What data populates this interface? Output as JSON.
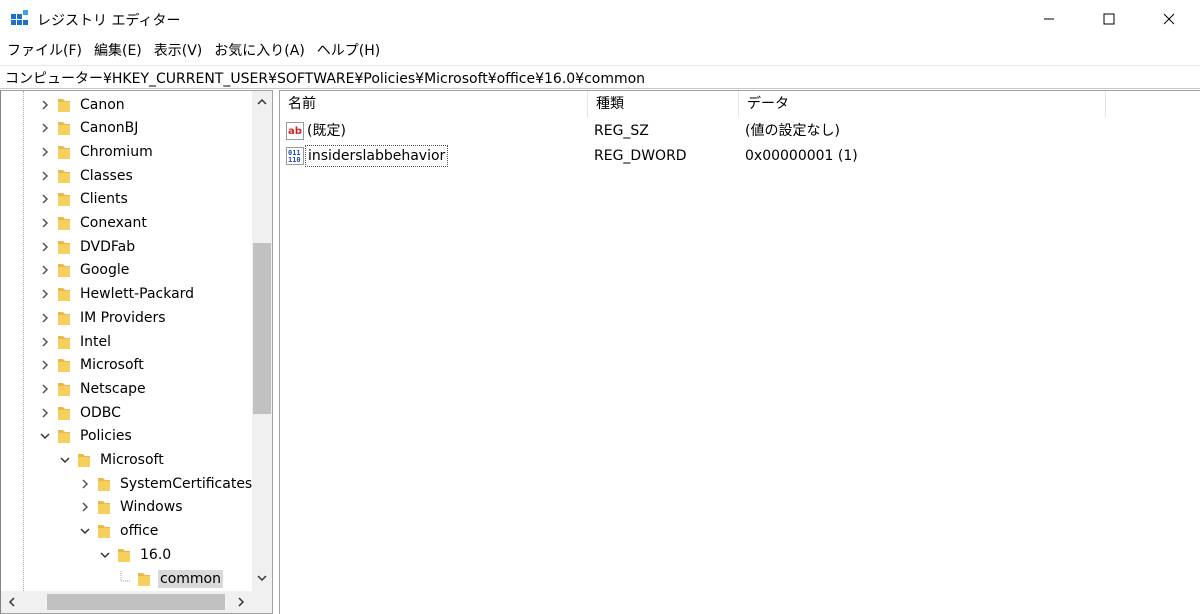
{
  "window": {
    "title": "レジストリ エディター",
    "icon": "regedit-app-icon"
  },
  "menu": [
    "ファイル(F)",
    "編集(E)",
    "表示(V)",
    "お気に入り(A)",
    "ヘルプ(H)"
  ],
  "address": "コンピューター¥HKEY_CURRENT_USER¥SOFTWARE¥Policies¥Microsoft¥office¥16.0¥common",
  "tree": {
    "items": [
      {
        "label": "Canon",
        "state": "collapsed"
      },
      {
        "label": "CanonBJ",
        "state": "collapsed"
      },
      {
        "label": "Chromium",
        "state": "collapsed"
      },
      {
        "label": "Classes",
        "state": "collapsed"
      },
      {
        "label": "Clients",
        "state": "collapsed"
      },
      {
        "label": "Conexant",
        "state": "collapsed"
      },
      {
        "label": "DVDFab",
        "state": "collapsed"
      },
      {
        "label": "Google",
        "state": "collapsed"
      },
      {
        "label": "Hewlett-Packard",
        "state": "collapsed"
      },
      {
        "label": "IM Providers",
        "state": "collapsed"
      },
      {
        "label": "Intel",
        "state": "collapsed"
      },
      {
        "label": "Microsoft",
        "state": "collapsed"
      },
      {
        "label": "Netscape",
        "state": "collapsed"
      },
      {
        "label": "ODBC",
        "state": "collapsed"
      },
      {
        "label": "Policies",
        "state": "expanded"
      },
      {
        "label": "Microsoft",
        "state": "expanded"
      },
      {
        "label": "SystemCertificates",
        "state": "collapsed"
      },
      {
        "label": "Windows",
        "state": "collapsed"
      },
      {
        "label": "office",
        "state": "expanded"
      },
      {
        "label": "16.0",
        "state": "expanded"
      },
      {
        "label": "common",
        "state": "leaf-selected"
      }
    ]
  },
  "list": {
    "columns": [
      "名前",
      "種類",
      "データ"
    ],
    "rows": [
      {
        "name": "(既定)",
        "type": "REG_SZ",
        "data": "(値の設定なし)",
        "icon": "string-value-icon"
      },
      {
        "name": "insiderslabbehavior",
        "type": "REG_DWORD",
        "data": "0x00000001 (1)",
        "icon": "binary-value-icon"
      }
    ]
  },
  "colors": {
    "folder": "#e8b94a",
    "selection": "#d9d9d9",
    "scroll_thumb": "#c1c1c1",
    "string_icon": "#cc2222",
    "binary_icon": "#1f4fa8"
  }
}
